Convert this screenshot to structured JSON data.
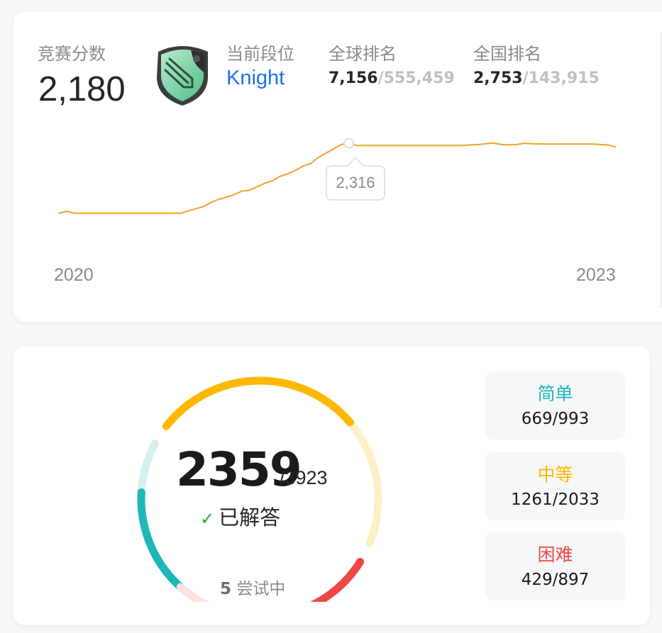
{
  "contest": {
    "rating_label": "竞赛分数",
    "rating_value": "2,180",
    "badge_label": "当前段位",
    "badge_name": "Knight",
    "global_rank_label": "全球排名",
    "global_rank": "7,156",
    "global_rank_total": "/555,459",
    "national_rank_label": "全国排名",
    "national_rank": "2,753",
    "national_rank_total": "/143,915",
    "tooltip_value": "2,316",
    "year_start": "2020",
    "year_end": "2023"
  },
  "colors": {
    "accent_blue": "#1a73e8",
    "line": "#f0a32a",
    "easy": "#1cb8b8",
    "medium": "#ffb800",
    "hard": "#ef4743"
  },
  "chart_data": {
    "type": "line",
    "title": "",
    "xlabel": "",
    "ylabel": "",
    "x_ticks": [
      "2020",
      "2023"
    ],
    "series": [
      {
        "values": [
          1500,
          1525,
          1502,
          1502,
          1502,
          1502,
          1502,
          1502,
          1502,
          1502,
          1502,
          1502,
          1502,
          1502,
          1502,
          1502,
          1502,
          1530,
          1555,
          1580,
          1630,
          1665,
          1690,
          1720,
          1760,
          1770,
          1810,
          1850,
          1880,
          1930,
          1960,
          2000,
          2050,
          2080,
          2150,
          2200,
          2250,
          2300,
          2316,
          2290,
          2290,
          2290,
          2290,
          2290,
          2290,
          2290,
          2290,
          2290,
          2290,
          2290,
          2290,
          2290,
          2290,
          2290,
          2295,
          2300,
          2310,
          2318,
          2300,
          2296,
          2300,
          2315,
          2310,
          2308,
          2306,
          2305,
          2305,
          2305,
          2305,
          2305,
          2305,
          2300,
          2295,
          2270
        ],
        "highlight": {
          "value": 2316
        }
      }
    ]
  },
  "solved": {
    "count": "2359",
    "total": "/3923",
    "label": "已解答",
    "attempting_count": "5",
    "attempting_label": "尝试中",
    "easy_fraction": 0.674,
    "medium_fraction": 0.62,
    "hard_fraction": 0.478
  },
  "difficulty": [
    {
      "name": "简单",
      "count": "669/993"
    },
    {
      "name": "中等",
      "count": "1261/2033"
    },
    {
      "name": "困难",
      "count": "429/897"
    }
  ]
}
